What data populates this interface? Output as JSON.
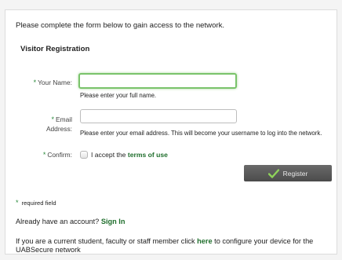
{
  "intro": "Please complete the form below to gain access to the network.",
  "section_title": "Visitor Registration",
  "name_field": {
    "asterisk": "*",
    "label": "Your Name:",
    "value": "",
    "hint": "Please enter your full name."
  },
  "email_field": {
    "asterisk": "*",
    "label_line1": "Email",
    "label_line2": "Address:",
    "value": "",
    "hint": "Please enter your email address. This will become your username to log into the network."
  },
  "confirm": {
    "asterisk": "*",
    "label": "Confirm:",
    "text": "I accept the",
    "link": "terms of use",
    "checked": false
  },
  "register_button": {
    "label": "Register",
    "icon": "check-icon"
  },
  "required_note": {
    "asterisk": "*",
    "text": "required field"
  },
  "account": {
    "text": "Already have an account?",
    "link": "Sign In"
  },
  "footer": {
    "prefix": "If you are a current student, faculty or staff member click",
    "link": "here",
    "suffix": "to configure your device for the UABSecure network"
  },
  "colors": {
    "accent_green": "#1f6e2c",
    "focus_border": "#7ac36b",
    "button_bg": "#555555"
  }
}
